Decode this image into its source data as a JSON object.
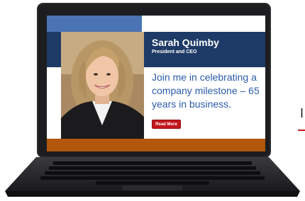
{
  "profile": {
    "name": "Sarah Quimby",
    "title": "President and CEO"
  },
  "message": "Join me in celebrating a company milestone – 65 years in business.",
  "cta": {
    "label": "Read More"
  },
  "colors": {
    "navy": "#1e3a66",
    "accent_blue": "#2a5ca8",
    "top_band": "#4a74b4",
    "button_red": "#c4161c",
    "bottom_band": "#b2570b"
  },
  "side_glyph": "I"
}
